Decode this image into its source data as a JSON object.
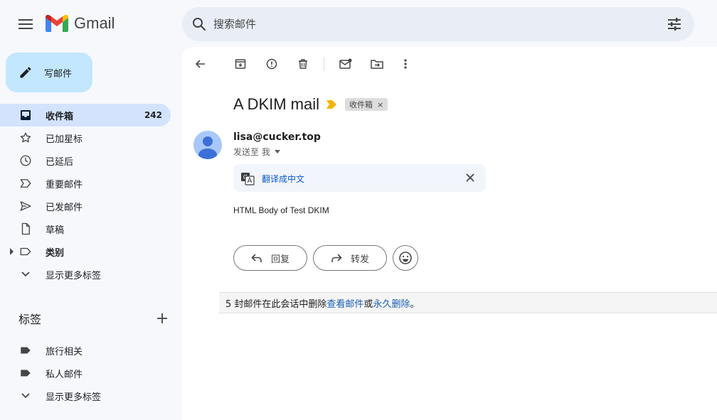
{
  "header": {
    "logo_text": "Gmail",
    "search_placeholder": "搜索邮件"
  },
  "sidebar": {
    "compose_label": "写邮件",
    "items": [
      {
        "label": "收件箱",
        "count": "242",
        "icon": "inbox-icon"
      },
      {
        "label": "已加星标",
        "icon": "star-icon"
      },
      {
        "label": "已延后",
        "icon": "clock-icon"
      },
      {
        "label": "重要邮件",
        "icon": "important-icon"
      },
      {
        "label": "已发邮件",
        "icon": "send-icon"
      },
      {
        "label": "草稿",
        "icon": "draft-icon"
      },
      {
        "label": "类别",
        "icon": "label-outline-icon"
      },
      {
        "label": "显示更多标签",
        "icon": "chevron-down-icon"
      }
    ],
    "labels_title": "标签",
    "labels": [
      {
        "label": "旅行相关",
        "icon": "label-filled-icon"
      },
      {
        "label": "私人邮件",
        "icon": "label-filled-icon"
      },
      {
        "label": "显示更多标签",
        "icon": "chevron-down-icon"
      }
    ]
  },
  "email": {
    "subject": "A DKIM mail",
    "chip_label": "收件箱",
    "chip_close": "×",
    "sender": "lisa@cucker.top",
    "to_line": "发送至 我",
    "translate_label": "翻译成中文",
    "body": "HTML Body of Test DKIM",
    "reply_label": "回复",
    "forward_label": "转发"
  },
  "deleted_notice": {
    "prefix": "5 封邮件在此会话中删除 ",
    "view_link": "查看邮件",
    "middle": "或",
    "delete_link": "永久删除",
    "suffix": "。"
  },
  "colors": {
    "accent": "#0b57d0",
    "compose_bg": "#c2e7ff",
    "active_nav_bg": "#d3e3fd",
    "importance_marker": "#f4b400"
  }
}
